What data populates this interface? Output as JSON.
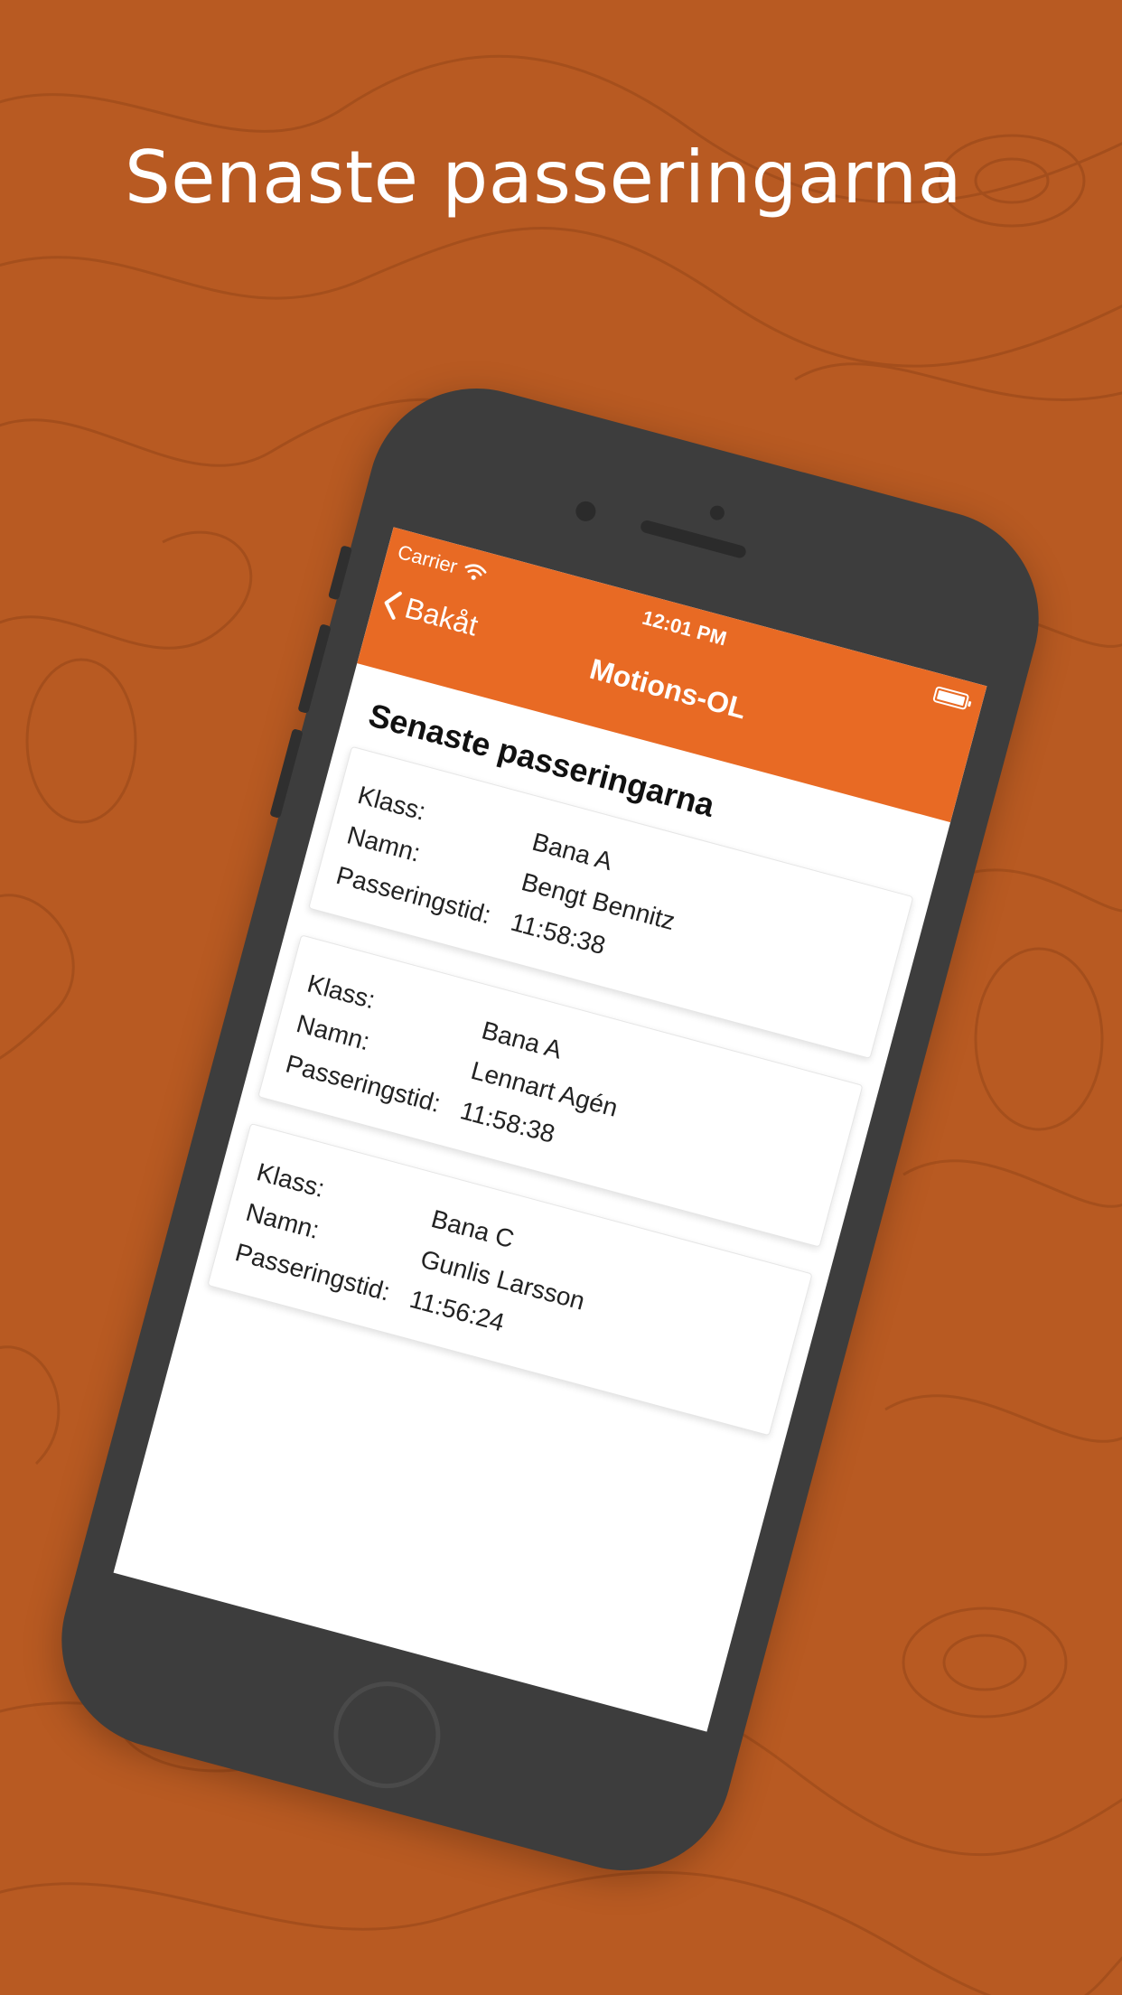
{
  "headline": "Senaste passeringarna",
  "status_bar": {
    "carrier": "Carrier",
    "time": "12:01 PM"
  },
  "nav": {
    "back_label": "Bakåt",
    "title": "Motions-OL"
  },
  "section_title": "Senaste passeringarna",
  "labels": {
    "class": "Klass:",
    "name": "Namn:",
    "time": "Passeringstid:"
  },
  "passings": [
    {
      "class": "Bana A",
      "name": "Bengt Bennitz",
      "time": "11:58:38"
    },
    {
      "class": "Bana A",
      "name": "Lennart Agén",
      "time": "11:58:38"
    },
    {
      "class": "Bana C",
      "name": "Gunlis Larsson",
      "time": "11:56:24"
    }
  ],
  "colors": {
    "background": "#b85a22",
    "accent": "#e86a24",
    "phone_body": "#3d3d3d"
  },
  "icons": {
    "wifi": "wifi-icon",
    "battery": "battery-icon",
    "back": "chevron-left-icon"
  }
}
